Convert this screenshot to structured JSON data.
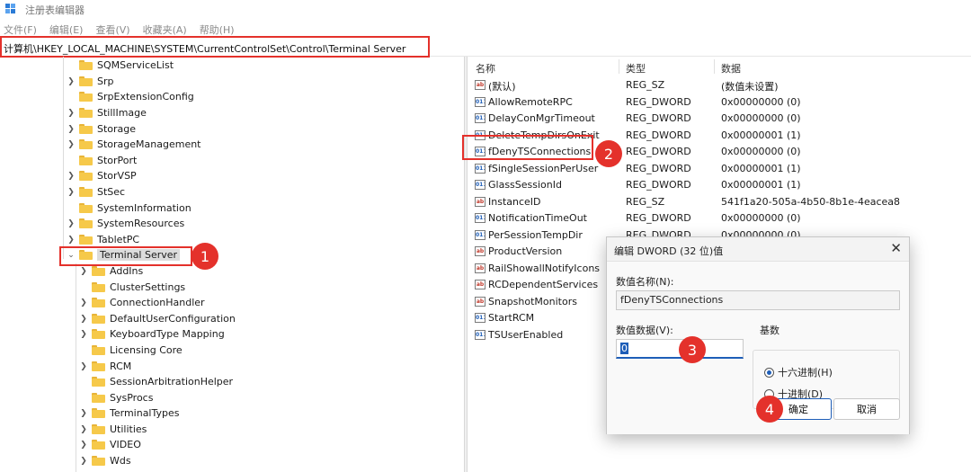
{
  "window": {
    "title": "注册表编辑器"
  },
  "menu": [
    "文件(F)",
    "编辑(E)",
    "查看(V)",
    "收藏夹(A)",
    "帮助(H)"
  ],
  "address": "计算机\\HKEY_LOCAL_MACHINE\\SYSTEM\\CurrentControlSet\\Control\\Terminal Server",
  "tree": {
    "parent_items": [
      "SQMServiceList",
      "Srp",
      "SrpExtensionConfig",
      "StillImage",
      "Storage",
      "StorageManagement",
      "StorPort",
      "StorVSP",
      "StSec",
      "SystemInformation",
      "SystemResources",
      "TabletPC"
    ],
    "selected": "Terminal Server",
    "child_items": [
      "AddIns",
      "ClusterSettings",
      "ConnectionHandler",
      "DefaultUserConfiguration",
      "KeyboardType Mapping",
      "Licensing Core",
      "RCM",
      "SessionArbitrationHelper",
      "SysProcs",
      "TerminalTypes",
      "Utilities",
      "VIDEO",
      "Wds"
    ]
  },
  "columns": {
    "name": "名称",
    "type": "类型",
    "data": "数据"
  },
  "values": [
    {
      "icon": "string-value-icon",
      "name": "(默认)",
      "type": "REG_SZ",
      "data": "(数值未设置)"
    },
    {
      "icon": "binary-value-icon",
      "name": "AllowRemoteRPC",
      "type": "REG_DWORD",
      "data": "0x00000000 (0)"
    },
    {
      "icon": "binary-value-icon",
      "name": "DelayConMgrTimeout",
      "type": "REG_DWORD",
      "data": "0x00000000 (0)"
    },
    {
      "icon": "binary-value-icon",
      "name": "DeleteTempDirsOnExit",
      "type": "REG_DWORD",
      "data": "0x00000001 (1)"
    },
    {
      "icon": "binary-value-icon",
      "name": "fDenyTSConnections",
      "type": "REG_DWORD",
      "data": "0x00000000 (0)"
    },
    {
      "icon": "binary-value-icon",
      "name": "fSingleSessionPerUser",
      "type": "REG_DWORD",
      "data": "0x00000001 (1)"
    },
    {
      "icon": "binary-value-icon",
      "name": "GlassSessionId",
      "type": "REG_DWORD",
      "data": "0x00000001 (1)"
    },
    {
      "icon": "string-value-icon",
      "name": "InstanceID",
      "type": "REG_SZ",
      "data": "541f1a20-505a-4b50-8b1e-4eacea8"
    },
    {
      "icon": "binary-value-icon",
      "name": "NotificationTimeOut",
      "type": "REG_DWORD",
      "data": "0x00000000 (0)"
    },
    {
      "icon": "binary-value-icon",
      "name": "PerSessionTempDir",
      "type": "REG_DWORD",
      "data": "0x00000000 (0)"
    },
    {
      "icon": "string-value-icon",
      "name": "ProductVersion",
      "type": "",
      "data": ""
    },
    {
      "icon": "string-value-icon",
      "name": "RailShowallNotifyIcons",
      "type": "",
      "data": ""
    },
    {
      "icon": "string-value-icon",
      "name": "RCDependentServices",
      "type": "",
      "data": ""
    },
    {
      "icon": "string-value-icon",
      "name": "SnapshotMonitors",
      "type": "",
      "data": ""
    },
    {
      "icon": "binary-value-icon",
      "name": "StartRCM",
      "type": "",
      "data": ""
    },
    {
      "icon": "binary-value-icon",
      "name": "TSUserEnabled",
      "type": "",
      "data": ""
    }
  ],
  "dialog": {
    "title": "编辑 DWORD (32 位)值",
    "close": "✕",
    "name_label": "数值名称(N):",
    "name_value": "fDenyTSConnections",
    "data_label": "数值数据(V):",
    "data_value": "0",
    "base_label": "基数",
    "hex_label": "十六进制(H)",
    "dec_label": "十进制(D)",
    "ok_label": "确定",
    "cancel_label": "取消"
  },
  "badges": [
    "1",
    "2",
    "3",
    "4"
  ],
  "colors": {
    "highlight_red": "#e4312b",
    "folder_yellow": "#f6c94a",
    "accent_blue": "#1e5eb8"
  }
}
